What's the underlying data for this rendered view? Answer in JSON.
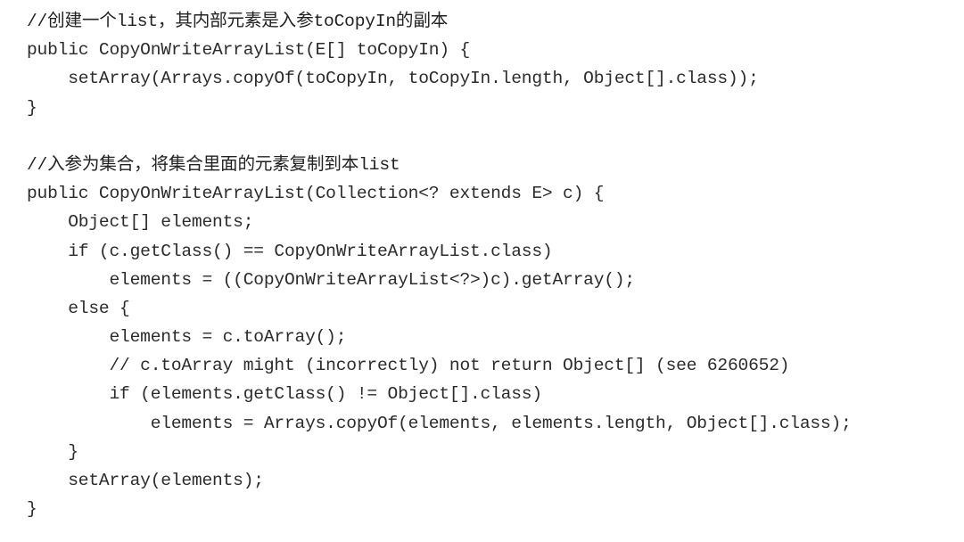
{
  "code": {
    "lines": [
      "//创建一个list，其内部元素是入参toCopyIn的副本",
      "public CopyOnWriteArrayList(E[] toCopyIn) {",
      "    setArray(Arrays.copyOf(toCopyIn, toCopyIn.length, Object[].class));",
      "}",
      "",
      "//入参为集合，将集合里面的元素复制到本list",
      "public CopyOnWriteArrayList(Collection<? extends E> c) {",
      "    Object[] elements;",
      "    if (c.getClass() == CopyOnWriteArrayList.class)",
      "        elements = ((CopyOnWriteArrayList<?>)c).getArray();",
      "    else {",
      "        elements = c.toArray();",
      "        // c.toArray might (incorrectly) not return Object[] (see 6260652)",
      "        if (elements.getClass() != Object[].class)",
      "            elements = Arrays.copyOf(elements, elements.length, Object[].class);",
      "    }",
      "    setArray(elements);",
      "}"
    ]
  }
}
